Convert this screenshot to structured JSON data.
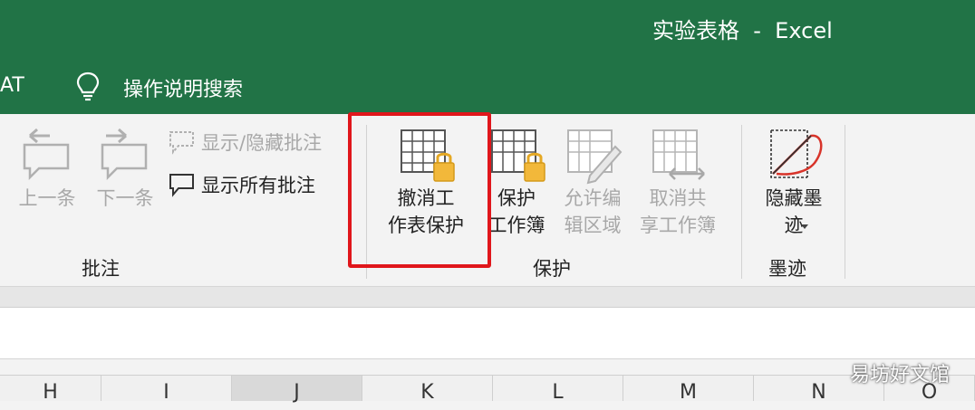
{
  "window": {
    "title": "实验表格  -  Excel"
  },
  "menubar": {
    "tab_fragment": "AT",
    "tell_me": "操作说明搜索"
  },
  "ribbon": {
    "comments_group": {
      "label": "批注",
      "previous": "上一条",
      "next": "下一条",
      "show_hide": "显示/隐藏批注",
      "show_all": "显示所有批注"
    },
    "protect_group": {
      "label": "保护",
      "unprotect_sheet": "撤消工\n作表保护",
      "protect_workbook": "保护\n工作簿",
      "allow_edit_ranges": "允许编\n辑区域",
      "unshare_workbook": "取消共\n享工作簿"
    },
    "ink_group": {
      "label": "墨迹",
      "hide_ink": "隐藏墨\n迹"
    }
  },
  "columns": [
    "H",
    "I",
    "J",
    "K",
    "L",
    "M",
    "N",
    "O"
  ],
  "selected_column": "J",
  "watermark": "易坊好文馆",
  "colors": {
    "excel_green": "#217346",
    "highlight_red": "#e0161b"
  }
}
